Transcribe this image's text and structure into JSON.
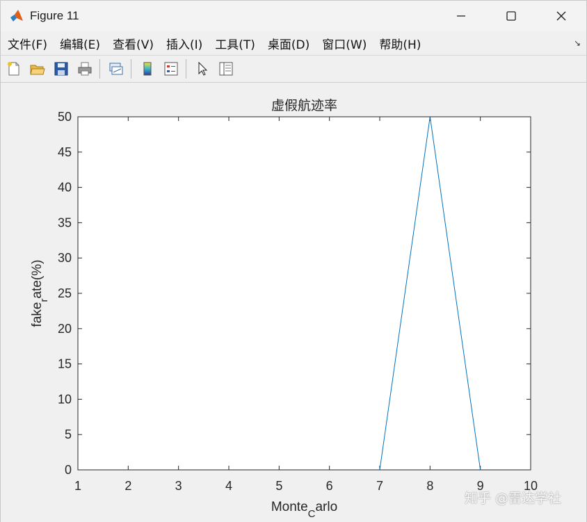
{
  "window": {
    "title": "Figure 11",
    "controls": {
      "minimize": "minimize-icon",
      "maximize": "maximize-icon",
      "close": "close-icon"
    }
  },
  "menubar": {
    "items": [
      "文件(F)",
      "编辑(E)",
      "查看(V)",
      "插入(I)",
      "工具(T)",
      "桌面(D)",
      "窗口(W)",
      "帮助(H)"
    ],
    "overflow_icon": "dock-arrow-icon"
  },
  "toolbar": {
    "icons": [
      "new-figure-icon",
      "open-file-icon",
      "save-icon",
      "print-icon",
      "link-plot-icon",
      "colorbar-icon",
      "legend-icon",
      "select-cursor-icon",
      "property-inspector-icon"
    ]
  },
  "chart_data": {
    "type": "line",
    "title": "虚假航迹率",
    "xlabel_main": "Monte",
    "xlabel_sub": "C",
    "xlabel_tail": "arlo",
    "ylabel_main": "fake",
    "ylabel_sub": "r",
    "ylabel_tail": "ate(%)",
    "xlim": [
      1,
      10
    ],
    "ylim": [
      0,
      50
    ],
    "x_ticks": [
      "1",
      "2",
      "3",
      "4",
      "5",
      "6",
      "7",
      "8",
      "9",
      "10"
    ],
    "y_ticks": [
      "0",
      "5",
      "10",
      "15",
      "20",
      "25",
      "30",
      "35",
      "40",
      "45",
      "50"
    ],
    "series": [
      {
        "x": [
          1,
          2,
          3,
          4,
          5,
          6,
          7,
          8,
          9,
          10
        ],
        "y": [
          0,
          0,
          0,
          0,
          0,
          0,
          0,
          50,
          0,
          0
        ],
        "color": "#0072bd"
      }
    ],
    "grid": false
  },
  "watermark": "知乎 @雷达学社"
}
